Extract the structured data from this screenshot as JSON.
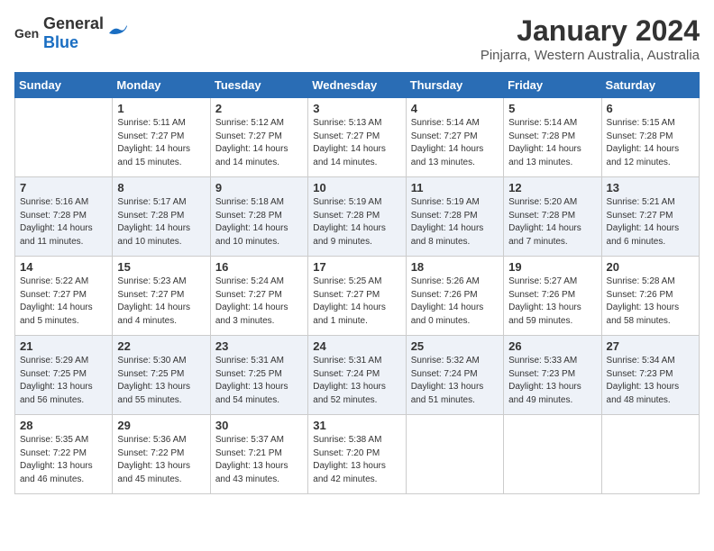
{
  "header": {
    "logo_general": "General",
    "logo_blue": "Blue",
    "month_title": "January 2024",
    "location": "Pinjarra, Western Australia, Australia"
  },
  "days_of_week": [
    "Sunday",
    "Monday",
    "Tuesday",
    "Wednesday",
    "Thursday",
    "Friday",
    "Saturday"
  ],
  "weeks": [
    [
      {
        "day": "",
        "info": ""
      },
      {
        "day": "1",
        "info": "Sunrise: 5:11 AM\nSunset: 7:27 PM\nDaylight: 14 hours\nand 15 minutes."
      },
      {
        "day": "2",
        "info": "Sunrise: 5:12 AM\nSunset: 7:27 PM\nDaylight: 14 hours\nand 14 minutes."
      },
      {
        "day": "3",
        "info": "Sunrise: 5:13 AM\nSunset: 7:27 PM\nDaylight: 14 hours\nand 14 minutes."
      },
      {
        "day": "4",
        "info": "Sunrise: 5:14 AM\nSunset: 7:27 PM\nDaylight: 14 hours\nand 13 minutes."
      },
      {
        "day": "5",
        "info": "Sunrise: 5:14 AM\nSunset: 7:28 PM\nDaylight: 14 hours\nand 13 minutes."
      },
      {
        "day": "6",
        "info": "Sunrise: 5:15 AM\nSunset: 7:28 PM\nDaylight: 14 hours\nand 12 minutes."
      }
    ],
    [
      {
        "day": "7",
        "info": "Sunrise: 5:16 AM\nSunset: 7:28 PM\nDaylight: 14 hours\nand 11 minutes."
      },
      {
        "day": "8",
        "info": "Sunrise: 5:17 AM\nSunset: 7:28 PM\nDaylight: 14 hours\nand 10 minutes."
      },
      {
        "day": "9",
        "info": "Sunrise: 5:18 AM\nSunset: 7:28 PM\nDaylight: 14 hours\nand 10 minutes."
      },
      {
        "day": "10",
        "info": "Sunrise: 5:19 AM\nSunset: 7:28 PM\nDaylight: 14 hours\nand 9 minutes."
      },
      {
        "day": "11",
        "info": "Sunrise: 5:19 AM\nSunset: 7:28 PM\nDaylight: 14 hours\nand 8 minutes."
      },
      {
        "day": "12",
        "info": "Sunrise: 5:20 AM\nSunset: 7:28 PM\nDaylight: 14 hours\nand 7 minutes."
      },
      {
        "day": "13",
        "info": "Sunrise: 5:21 AM\nSunset: 7:27 PM\nDaylight: 14 hours\nand 6 minutes."
      }
    ],
    [
      {
        "day": "14",
        "info": "Sunrise: 5:22 AM\nSunset: 7:27 PM\nDaylight: 14 hours\nand 5 minutes."
      },
      {
        "day": "15",
        "info": "Sunrise: 5:23 AM\nSunset: 7:27 PM\nDaylight: 14 hours\nand 4 minutes."
      },
      {
        "day": "16",
        "info": "Sunrise: 5:24 AM\nSunset: 7:27 PM\nDaylight: 14 hours\nand 3 minutes."
      },
      {
        "day": "17",
        "info": "Sunrise: 5:25 AM\nSunset: 7:27 PM\nDaylight: 14 hours\nand 1 minute."
      },
      {
        "day": "18",
        "info": "Sunrise: 5:26 AM\nSunset: 7:26 PM\nDaylight: 14 hours\nand 0 minutes."
      },
      {
        "day": "19",
        "info": "Sunrise: 5:27 AM\nSunset: 7:26 PM\nDaylight: 13 hours\nand 59 minutes."
      },
      {
        "day": "20",
        "info": "Sunrise: 5:28 AM\nSunset: 7:26 PM\nDaylight: 13 hours\nand 58 minutes."
      }
    ],
    [
      {
        "day": "21",
        "info": "Sunrise: 5:29 AM\nSunset: 7:25 PM\nDaylight: 13 hours\nand 56 minutes."
      },
      {
        "day": "22",
        "info": "Sunrise: 5:30 AM\nSunset: 7:25 PM\nDaylight: 13 hours\nand 55 minutes."
      },
      {
        "day": "23",
        "info": "Sunrise: 5:31 AM\nSunset: 7:25 PM\nDaylight: 13 hours\nand 54 minutes."
      },
      {
        "day": "24",
        "info": "Sunrise: 5:31 AM\nSunset: 7:24 PM\nDaylight: 13 hours\nand 52 minutes."
      },
      {
        "day": "25",
        "info": "Sunrise: 5:32 AM\nSunset: 7:24 PM\nDaylight: 13 hours\nand 51 minutes."
      },
      {
        "day": "26",
        "info": "Sunrise: 5:33 AM\nSunset: 7:23 PM\nDaylight: 13 hours\nand 49 minutes."
      },
      {
        "day": "27",
        "info": "Sunrise: 5:34 AM\nSunset: 7:23 PM\nDaylight: 13 hours\nand 48 minutes."
      }
    ],
    [
      {
        "day": "28",
        "info": "Sunrise: 5:35 AM\nSunset: 7:22 PM\nDaylight: 13 hours\nand 46 minutes."
      },
      {
        "day": "29",
        "info": "Sunrise: 5:36 AM\nSunset: 7:22 PM\nDaylight: 13 hours\nand 45 minutes."
      },
      {
        "day": "30",
        "info": "Sunrise: 5:37 AM\nSunset: 7:21 PM\nDaylight: 13 hours\nand 43 minutes."
      },
      {
        "day": "31",
        "info": "Sunrise: 5:38 AM\nSunset: 7:20 PM\nDaylight: 13 hours\nand 42 minutes."
      },
      {
        "day": "",
        "info": ""
      },
      {
        "day": "",
        "info": ""
      },
      {
        "day": "",
        "info": ""
      }
    ]
  ]
}
